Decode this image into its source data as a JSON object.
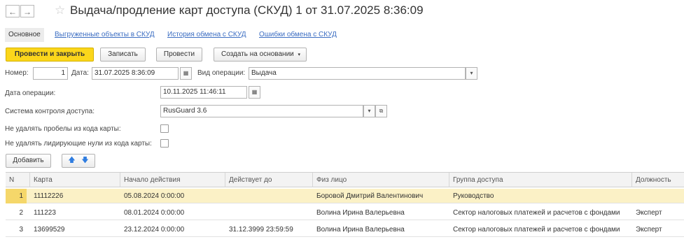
{
  "window": {
    "title": "Выдача/продление карт доступа (СКУД) 1 от 31.07.2025 8:36:09",
    "nav_back": "←",
    "nav_forward": "→",
    "star": "☆"
  },
  "tabs": [
    "Основное",
    "Выгруженные объекты в СКУД",
    "История обмена с СКУД",
    "Ошибки обмена с СКУД"
  ],
  "toolbar": {
    "post_close": "Провести и закрыть",
    "save": "Записать",
    "post": "Провести",
    "create_based": "Создать на основании"
  },
  "form": {
    "number_label": "Номер:",
    "number_value": "1",
    "date_label": "Дата:",
    "date_value": "31.07.2025  8:36:09",
    "op_type_label": "Вид операции:",
    "op_type_value": "Выдача",
    "op_date_label": "Дата операции:",
    "op_date_value": "10.11.2025 11:46:11",
    "system_label": "Система контроля доступа:",
    "system_value": "RusGuard 3.6",
    "no_trim_label": "Не удалять пробелы из кода карты:",
    "no_trim_checked": false,
    "no_zeros_label": "Не удалять лидирующие нули из кода карты:",
    "no_zeros_checked": false
  },
  "table_toolbar": {
    "add": "Добавить"
  },
  "table": {
    "columns": [
      "N",
      "Карта",
      "Начало действия",
      "Действует до",
      "Физ лицо",
      "Группа доступа",
      "Должность"
    ],
    "rows": [
      {
        "n": "1",
        "card": "11112226",
        "start": "05.08.2024 0:00:00",
        "until": "",
        "person": "Боровой Дмитрий Валентинович",
        "group": "Руководство",
        "position": ""
      },
      {
        "n": "2",
        "card": "111223",
        "start": "08.01.2024 0:00:00",
        "until": "",
        "person": "Волина Ирина Валерьевна",
        "group": "Сектор налоговых платежей и расчетов с фондами",
        "position": "Эксперт"
      },
      {
        "n": "3",
        "card": "13699529",
        "start": "23.12.2024 0:00:00",
        "until": "31.12.3999 23:59:59",
        "person": "Волина Ирина Валерьевна",
        "group": "Сектор налоговых платежей и расчетов с фондами",
        "position": "Эксперт"
      }
    ]
  },
  "colors": {
    "accent": "#fbd61b",
    "link": "#3b6dc2",
    "selected_row": "#fbf1c6"
  }
}
